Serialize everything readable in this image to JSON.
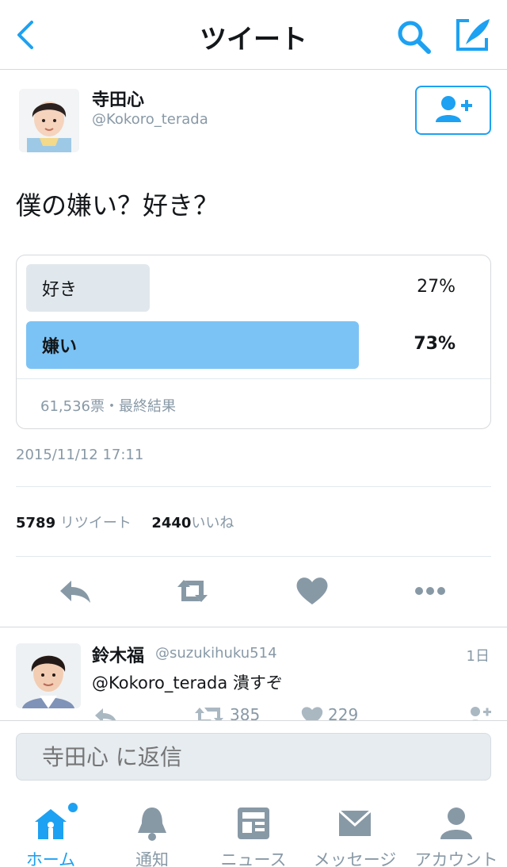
{
  "header": {
    "title": "ツイート"
  },
  "tweet": {
    "author_name": "寺田心",
    "author_handle": "@Kokoro_terada",
    "text": "僕の嫌い？好き？",
    "poll": {
      "options": [
        {
          "label": "好き",
          "percent": 27,
          "percent_text": "27%"
        },
        {
          "label": "嫌い",
          "percent": 73,
          "percent_text": "73%"
        }
      ],
      "meta": "61,536票・最終結果"
    },
    "timestamp": "2015/11/12 17:11",
    "retweet_count": "5789",
    "retweet_label": " リツイート",
    "like_count": "2440",
    "like_label": "いいね"
  },
  "reply": {
    "name": "鈴木福",
    "handle": "@suzukihuku514",
    "time": "1日",
    "text": "@Kokoro_terada 潰すぞ",
    "retweets": "385",
    "likes": "229"
  },
  "reply_box": {
    "placeholder": "寺田心 に返信"
  },
  "tabs": [
    {
      "label": "ホーム"
    },
    {
      "label": "通知"
    },
    {
      "label": "ニュース"
    },
    {
      "label": "メッセージ"
    },
    {
      "label": "アカウント"
    }
  ],
  "colors": {
    "accent": "#1da1f2",
    "poll_winner": "#7cc3f5",
    "poll_other": "#e1e8ed",
    "muted": "#8899a6"
  }
}
